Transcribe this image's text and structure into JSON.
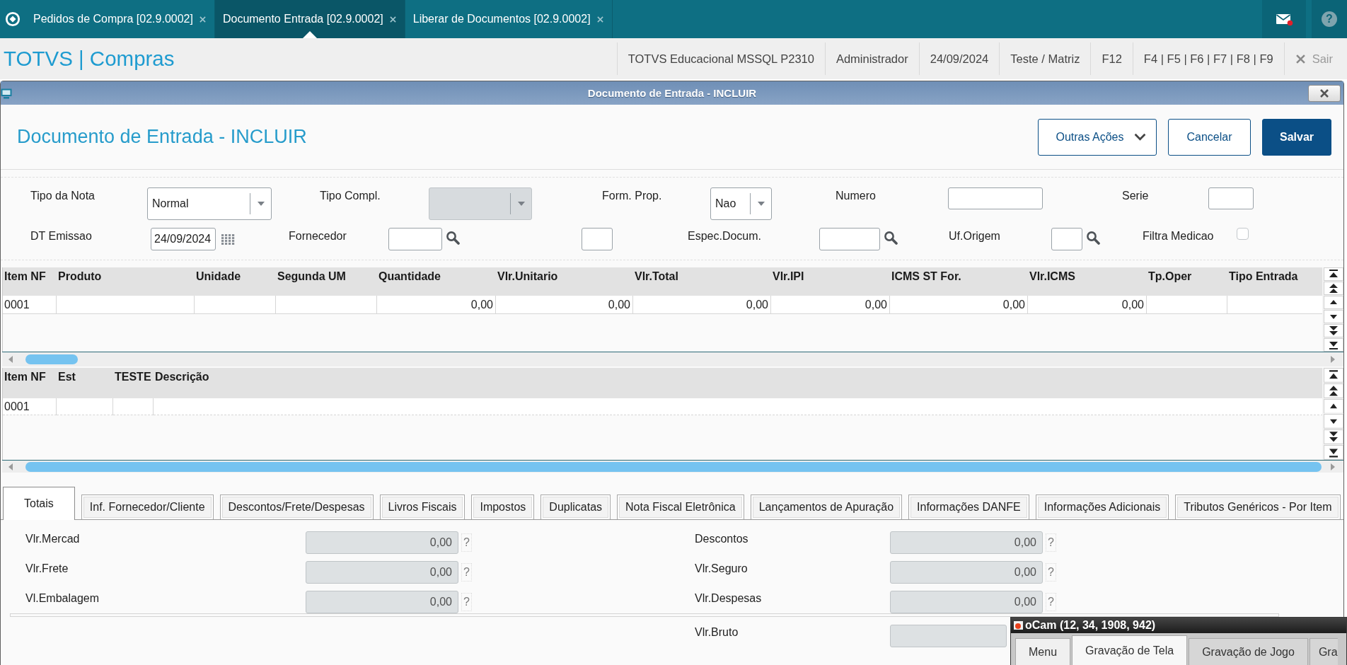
{
  "top_bar": {
    "tabs": [
      {
        "label": "Pedidos de Compra [02.9.0002]",
        "selected": false
      },
      {
        "label": "Documento Entrada [02.9.0002]",
        "selected": true
      },
      {
        "label": "Liberar de Documentos [02.9.0002]",
        "selected": false
      }
    ],
    "help": "?"
  },
  "app_bar": {
    "title": "TOTVS | Compras",
    "info": [
      "TOTVS Educacional MSSQL P2310",
      "Administrador",
      "24/09/2024",
      "Teste / Matriz",
      "F12",
      "F4 | F5 | F6 | F7 | F8 | F9"
    ],
    "exit": "Sair"
  },
  "window": {
    "title": "Documento de Entrada - INCLUIR",
    "heading": "Documento de Entrada - INCLUIR",
    "buttons": [
      {
        "label": "Outras Ações",
        "kind": "menu"
      },
      {
        "label": "Cancelar",
        "kind": "secondary"
      },
      {
        "label": "Salvar",
        "kind": "primary"
      }
    ]
  },
  "form": {
    "fields": [
      {
        "label": "Tipo da Nota",
        "kind": "select",
        "value": "Normal",
        "disabled": false
      },
      {
        "label": "Tipo Compl.",
        "kind": "select",
        "disabled": true
      },
      {
        "label": "Form. Prop.",
        "kind": "select",
        "value": "Nao",
        "disabled": false
      },
      {
        "label": "Numero",
        "kind": "input",
        "disabled": false
      },
      {
        "label": "Serie",
        "kind": "input",
        "disabled": false
      },
      {
        "label": "DT Emissao",
        "kind": "date",
        "value": "24/09/2024",
        "disabled": false
      },
      {
        "label": "Fornecedor",
        "kind": "lookup",
        "disabled": false
      },
      {
        "kind": "input",
        "disabled": false
      },
      {
        "label": "Espec.Docum.",
        "kind": "lookup",
        "disabled": false
      },
      {
        "label": "Uf.Origem",
        "kind": "lookup",
        "disabled": false
      },
      {
        "label": "Filtra Medicao",
        "kind": "checkbox",
        "checked": false,
        "disabled": false
      }
    ]
  },
  "items_grid": {
    "columns": [
      {
        "label": "Item NF",
        "kind": "text"
      },
      {
        "label": "Produto",
        "kind": "text"
      },
      {
        "label": "Unidade",
        "kind": "text"
      },
      {
        "label": "Segunda UM",
        "kind": "text"
      },
      {
        "label": "Quantidade",
        "kind": "number"
      },
      {
        "label": "Vlr.Unitario",
        "kind": "number"
      },
      {
        "label": "Vlr.Total",
        "kind": "number"
      },
      {
        "label": "Vlr.IPI",
        "kind": "number"
      },
      {
        "label": "ICMS ST For.",
        "kind": "number"
      },
      {
        "label": "Vlr.ICMS",
        "kind": "number"
      },
      {
        "label": "Tp.Oper",
        "kind": "text"
      },
      {
        "label": "Tipo Entrada",
        "kind": "text"
      }
    ],
    "rows": [
      {
        "cells": [
          "0001",
          null,
          null,
          null,
          "0,00",
          "0,00",
          "0,00",
          "0,00",
          "0,00",
          "0,00",
          null,
          null
        ]
      }
    ]
  },
  "detail_grid": {
    "columns": [
      {
        "label": "Item NF"
      },
      {
        "label": "Est"
      },
      {
        "label": "TESTE"
      },
      {
        "label": "Descrição"
      }
    ],
    "rows": [
      {
        "cells": [
          "0001",
          null,
          null,
          null
        ]
      }
    ]
  },
  "totals": {
    "tabs": [
      {
        "label": "Totais",
        "selected": true
      },
      {
        "label": "Inf. Fornecedor/Cliente",
        "selected": false
      },
      {
        "label": "Descontos/Frete/Despesas",
        "selected": false
      },
      {
        "label": "Livros Fiscais",
        "selected": false
      },
      {
        "label": "Impostos",
        "selected": false
      },
      {
        "label": "Duplicatas",
        "selected": false
      },
      {
        "label": "Nota Fiscal Eletrônica",
        "selected": false
      },
      {
        "label": "Lançamentos de Apuração",
        "selected": false
      },
      {
        "label": "Informações DANFE",
        "selected": false
      },
      {
        "label": "Informações Adicionais",
        "selected": false
      },
      {
        "label": "Tributos Genéricos - Por Item",
        "selected": false
      }
    ],
    "columns": [
      [
        {
          "label": "Vlr.Mercad",
          "value": "0,00",
          "help": "?",
          "disabled": true
        },
        {
          "label": "Vlr.Frete",
          "value": "0,00",
          "help": "?",
          "disabled": true
        },
        {
          "label": "Vl.Embalagem",
          "value": "0,00",
          "help": "?",
          "disabled": true
        }
      ],
      [
        {
          "label": "Descontos",
          "value": "0,00",
          "help": "?",
          "disabled": true
        },
        {
          "label": "Vlr.Seguro",
          "value": "0,00",
          "help": "?",
          "disabled": true
        },
        {
          "label": "Vlr.Despesas",
          "value": "0,00",
          "help": "?",
          "disabled": true
        }
      ]
    ],
    "after_divider": [
      {
        "label": "Vlr.Bruto",
        "disabled": true
      }
    ]
  },
  "overlay_window": {
    "title": "oCam (12, 34, 1908, 942)",
    "tabs": [
      {
        "label": "Menu",
        "selected": false
      },
      {
        "label": "Gravação de Tela",
        "selected": true
      },
      {
        "label": "Gravação de Jogo",
        "selected": false
      },
      {
        "label": "Gra",
        "selected": false
      }
    ]
  }
}
